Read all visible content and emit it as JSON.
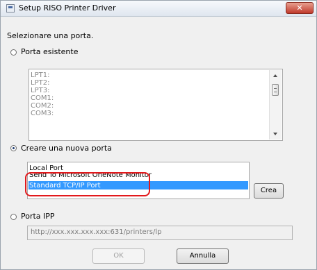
{
  "window": {
    "title": "Setup RISO Printer Driver",
    "close_glyph": "✕"
  },
  "instruction": "Selezionare una porta.",
  "existing_port": {
    "label": "Porta esistente",
    "selected": false,
    "items": [
      "LPT1:",
      "LPT2:",
      "LPT3:",
      "COM1:",
      "COM2:",
      "COM3:"
    ]
  },
  "new_port": {
    "label": "Creare una nuova porta",
    "selected": true,
    "items": [
      "Local Port",
      "Send To Microsoft OneNote Monitor",
      "Standard TCP/IP Port"
    ],
    "selected_item": "Standard TCP/IP Port",
    "create_label": "Crea"
  },
  "ipp": {
    "label": "Porta IPP",
    "selected": false,
    "url_placeholder": "http://xxx.xxx.xxx.xxx:631/printers/lp"
  },
  "buttons": {
    "ok": "OK",
    "cancel": "Annulla"
  },
  "colors": {
    "selection": "#3399ff",
    "highlight": "#e2191c",
    "close_button": "#c0392b"
  }
}
